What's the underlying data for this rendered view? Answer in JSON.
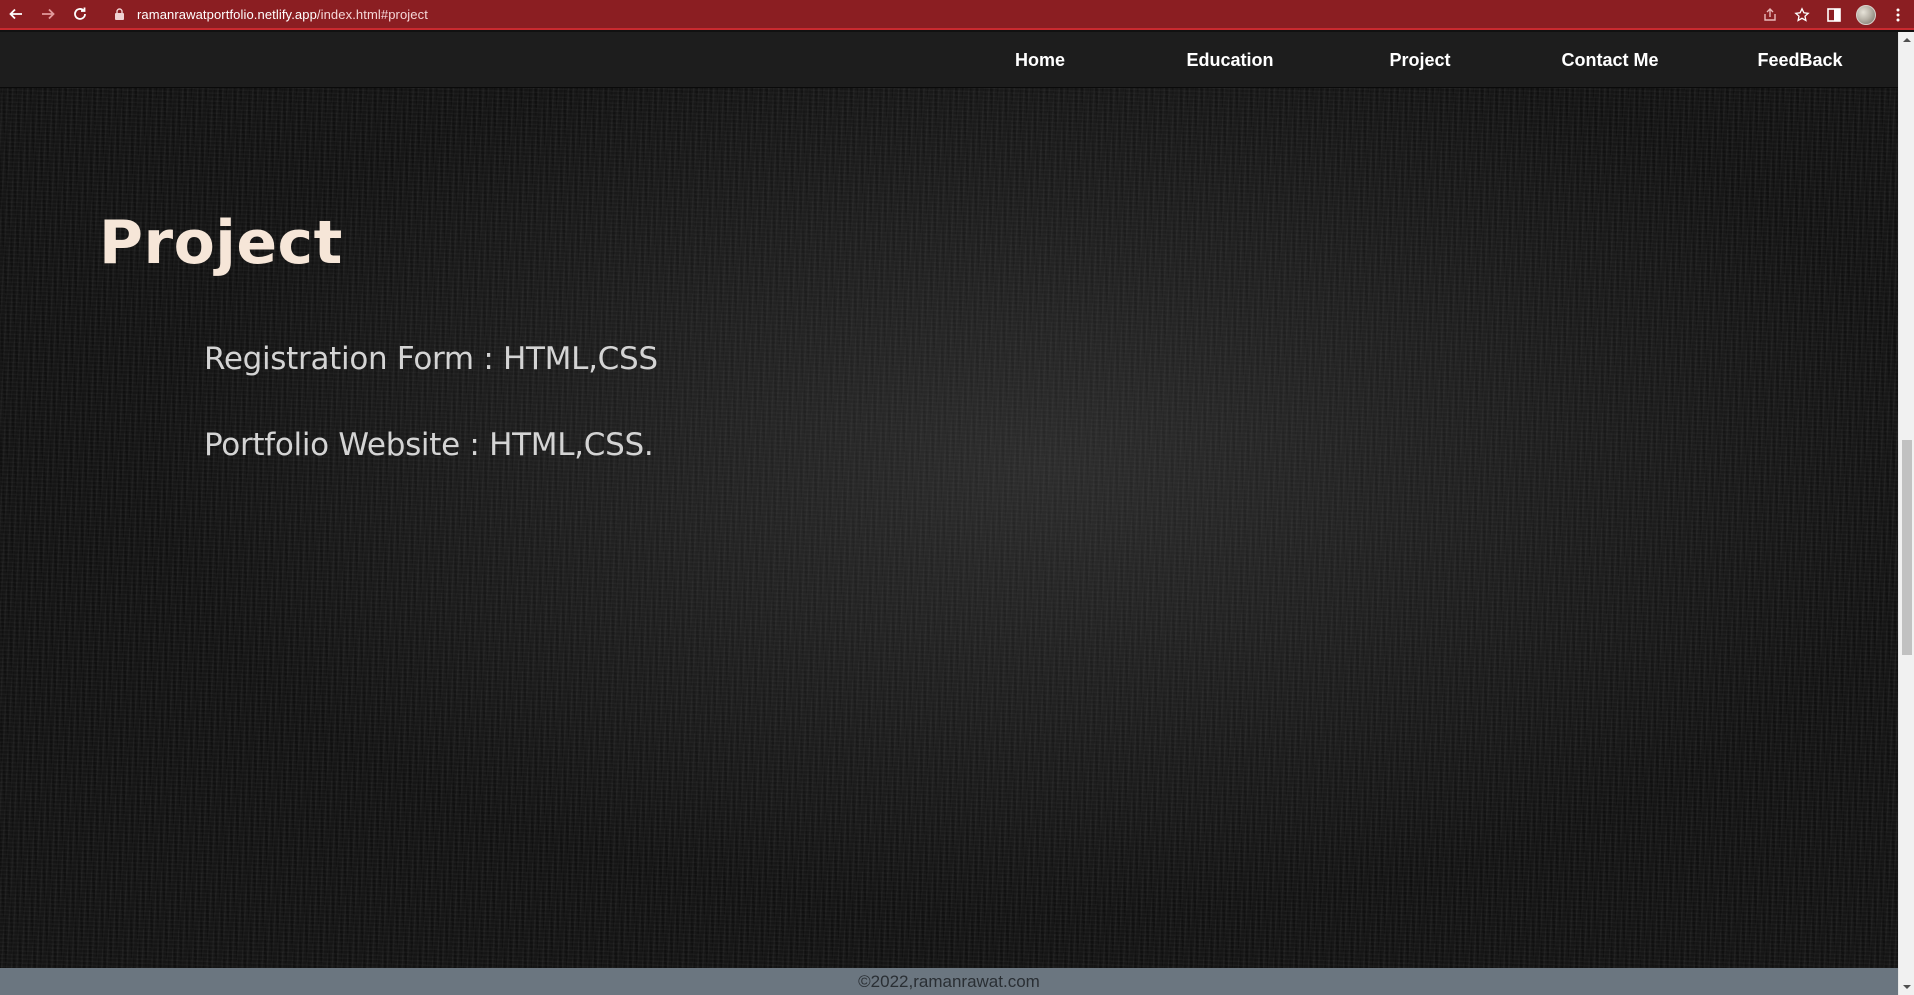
{
  "browser": {
    "url_host": "ramanrawatportfolio.netlify.app",
    "url_path": "/index.html#project",
    "icons": [
      "back-icon",
      "forward-icon",
      "reload-icon",
      "lock-icon",
      "share-icon",
      "star-icon",
      "side-panel-icon",
      "avatar",
      "more-icon"
    ]
  },
  "nav": {
    "items": [
      {
        "label": "Home"
      },
      {
        "label": "Education"
      },
      {
        "label": "Project"
      },
      {
        "label": "Contact Me"
      },
      {
        "label": "FeedBack"
      }
    ]
  },
  "section": {
    "title": "Project",
    "projects": [
      "Registration Form : HTML,CSS",
      "Portfolio Website : HTML,CSS."
    ]
  },
  "footer": {
    "text": "©2022,ramanrawat.com"
  },
  "colors": {
    "browser_bar": "#8b1e22",
    "nav_bg": "#1d1d1d",
    "title": "#f6e6d8",
    "footer_bg": "#6b7680"
  }
}
